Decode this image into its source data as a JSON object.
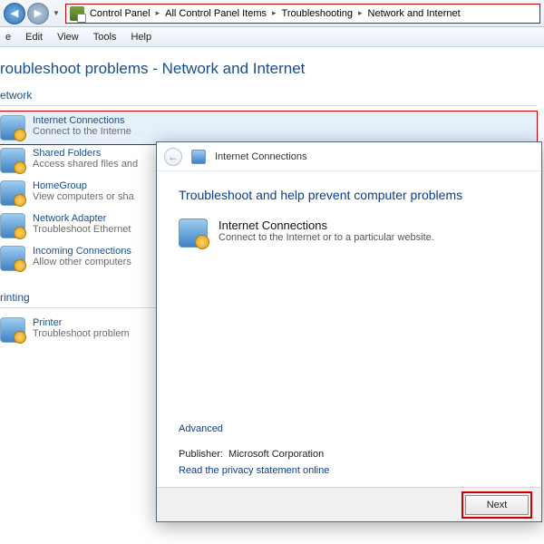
{
  "breadcrumb": [
    "Control Panel",
    "All Control Panel Items",
    "Troubleshooting",
    "Network and Internet"
  ],
  "menu": {
    "edit": "Edit",
    "view": "View",
    "tools": "Tools",
    "help": "Help",
    "file_partial": "e"
  },
  "page_title_partial": "roubleshoot problems - Network and Internet",
  "categories": {
    "network": "etwork",
    "printing": "rinting"
  },
  "items": {
    "internet": {
      "title": "Internet Connections",
      "sub": "Connect to the Interne"
    },
    "shared": {
      "title": "Shared Folders",
      "sub": "Access shared files and"
    },
    "homegroup": {
      "title": "HomeGroup",
      "sub": "View computers or sha"
    },
    "adapter": {
      "title": "Network Adapter",
      "sub": "Troubleshoot Ethernet"
    },
    "incoming": {
      "title": "Incoming Connections",
      "sub": "Allow other computers"
    },
    "printer": {
      "title": "Printer",
      "sub": "Troubleshoot problem"
    }
  },
  "dialog": {
    "head": "Internet Connections",
    "heading": "Troubleshoot and help prevent computer problems",
    "item_title": "Internet Connections",
    "item_sub": "Connect to the Internet or to a particular website.",
    "advanced": "Advanced",
    "publisher_label": "Publisher:",
    "publisher_value": "Microsoft Corporation",
    "privacy": "Read the privacy statement online",
    "next": "Next"
  }
}
